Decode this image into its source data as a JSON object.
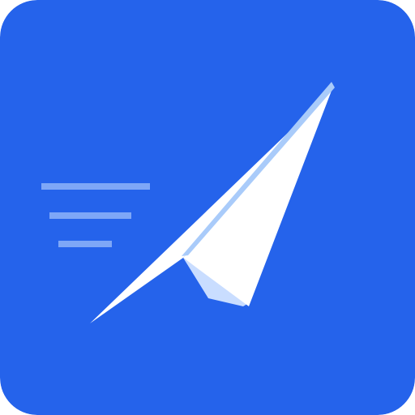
{
  "icon": {
    "name": "paper-plane-icon",
    "colors": {
      "background": "#2563EB",
      "plane_main": "#FFFFFF",
      "plane_fold": "#C9DDFF",
      "plane_edge": "#A9CBFA",
      "speed_lines": "#7EA7F7"
    }
  }
}
